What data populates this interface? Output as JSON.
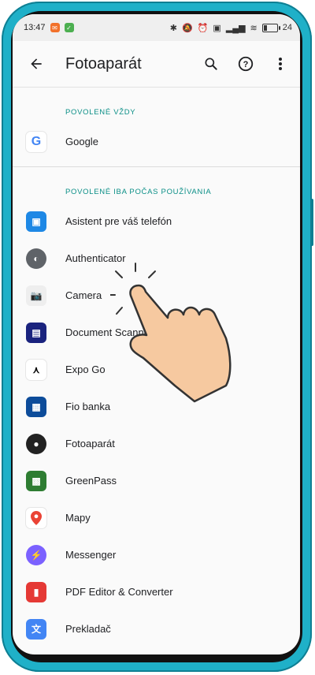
{
  "status": {
    "time": "13:47",
    "battery": "24"
  },
  "app_bar": {
    "title": "Fotoaparát"
  },
  "sections": [
    {
      "header": "POVOLENÉ VŽDY",
      "items": [
        {
          "label": "Google"
        }
      ]
    },
    {
      "header": "POVOLENÉ IBA POČAS POUŽÍVANIA",
      "items": [
        {
          "label": "Asistent pre váš telefón"
        },
        {
          "label": "Authenticator"
        },
        {
          "label": "Camera"
        },
        {
          "label": "Document Scanner"
        },
        {
          "label": "Expo Go"
        },
        {
          "label": "Fio banka"
        },
        {
          "label": "Fotoaparát"
        },
        {
          "label": "GreenPass"
        },
        {
          "label": "Mapy"
        },
        {
          "label": "Messenger"
        },
        {
          "label": "PDF Editor & Converter"
        },
        {
          "label": "Prekladač"
        }
      ]
    }
  ]
}
